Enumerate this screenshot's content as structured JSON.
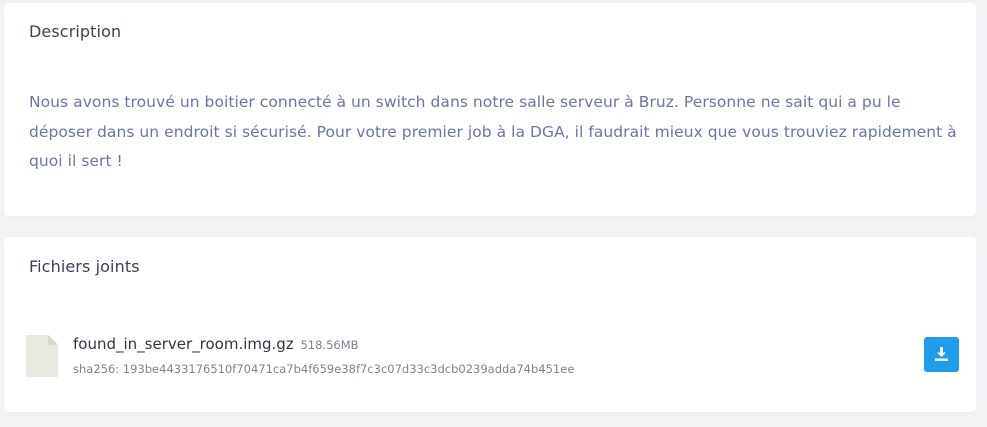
{
  "description": {
    "title": "Description",
    "text": "Nous avons trouvé un boitier connecté à un switch dans notre salle serveur à Bruz. Personne ne sait qui a pu le déposer dans un endroit si sécurisé. Pour votre premier job à la DGA, il faudrait mieux que vous trouviez rapidement à quoi il sert !"
  },
  "attachments": {
    "title": "Fichiers joints",
    "files": [
      {
        "name": "found_in_server_room.img.gz",
        "size": "518.56MB",
        "hash": "sha256: 193be4433176510f70471ca7b4f659e38f7c3c07d33c3dcb0239adda74b451ee",
        "icon": "file-icon",
        "action_icon": "download-icon"
      }
    ]
  },
  "colors": {
    "background": "#f3f3f6",
    "card": "#ffffff",
    "title": "#3d4354",
    "description_text": "#6a76a3",
    "download_button": "#1e9cee"
  }
}
